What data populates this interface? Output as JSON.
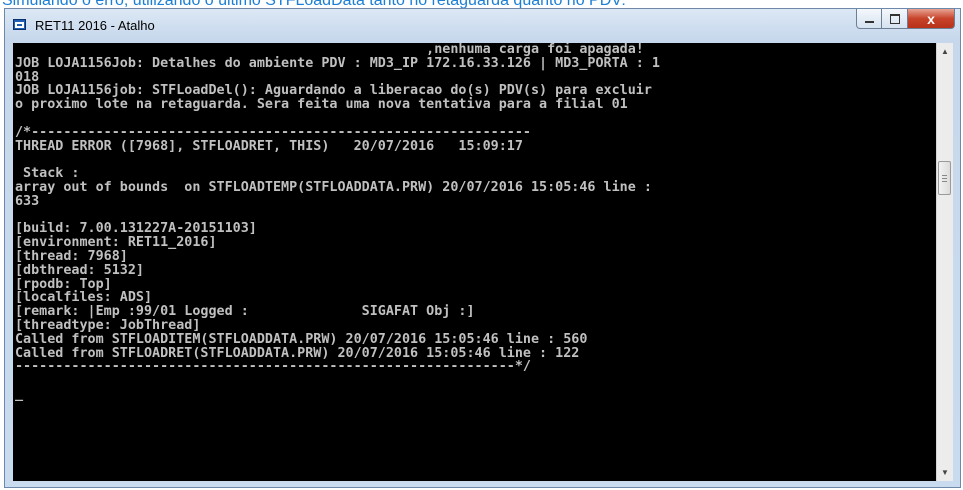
{
  "page_caption": "Simulando o erro, utilizando o último STFLoadData tanto no retaguarda quanto no PDV:",
  "window": {
    "title": "RET11 2016 - Atalho",
    "app_icon": "console-window-icon",
    "controls": {
      "minimize": "minimize-icon",
      "maximize": "maximize-icon",
      "close_label": "x"
    }
  },
  "console": {
    "background": "#000000",
    "text_color": "#c0c0c0",
    "lines": [
      "                                                   ,nenhuma carga foi apagada!",
      "JOB LOJA1156Job: Detalhes do ambiente PDV : MD3_IP 172.16.33.126 | MD3_PORTA : 1",
      "018",
      "JOB LOJA1156job: STFLoadDel(): Aguardando a liberacao do(s) PDV(s) para excluir",
      "o proximo lote na retaguarda. Sera feita uma nova tentativa para a filial 01",
      "",
      "/*--------------------------------------------------------------",
      "THREAD ERROR ([7968], STFLOADRET, THIS)   20/07/2016   15:09:17",
      "",
      " Stack :",
      "array out of bounds  on STFLOADTEMP(STFLOADDATA.PRW) 20/07/2016 15:05:46 line :",
      "633",
      "",
      "[build: 7.00.131227A-20151103]",
      "[environment: RET11_2016]",
      "[thread: 7968]",
      "[dbthread: 5132]",
      "[rpodb: Top]",
      "[localfiles: ADS]",
      "[remark: |Emp :99/01 Logged :              SIGAFAT Obj :]",
      "[threadtype: JobThread]",
      "Called from STFLOADITEM(STFLOADDATA.PRW) 20/07/2016 15:05:46 line : 560",
      "Called from STFLOADRET(STFLOADDATA.PRW) 20/07/2016 15:05:46 line : 122",
      "--------------------------------------------------------------*/",
      "",
      "_"
    ]
  },
  "scrollbar": {
    "up_icon": "scroll-up-arrow-icon",
    "down_icon": "scroll-down-arrow-icon"
  }
}
